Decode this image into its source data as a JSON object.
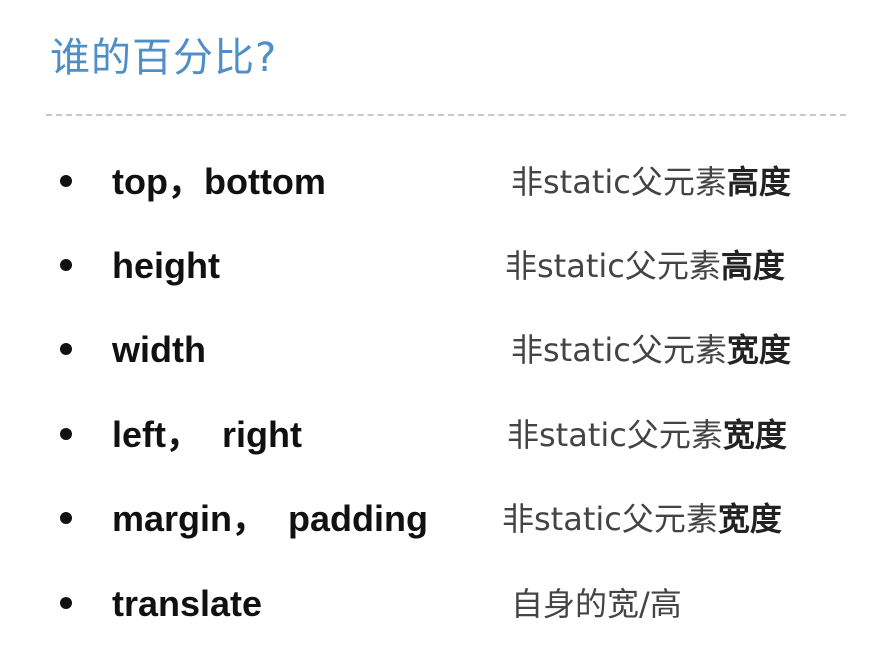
{
  "title": "谁的百分比?",
  "rows": [
    {
      "term": "top，bottom",
      "desc_plain": "非static父元素",
      "desc_strong": "高度"
    },
    {
      "term": "height",
      "desc_plain": "非static父元素",
      "desc_strong": "高度"
    },
    {
      "term": "width",
      "desc_plain": "非static父元素",
      "desc_strong": "宽度"
    },
    {
      "term": "left，  right",
      "desc_plain": "非static父元素",
      "desc_strong": "宽度"
    },
    {
      "term": "margin，  padding",
      "desc_plain": "非static父元素",
      "desc_strong": "宽度"
    },
    {
      "term": "translate",
      "desc_plain": "自身的宽/高",
      "desc_strong": ""
    }
  ]
}
